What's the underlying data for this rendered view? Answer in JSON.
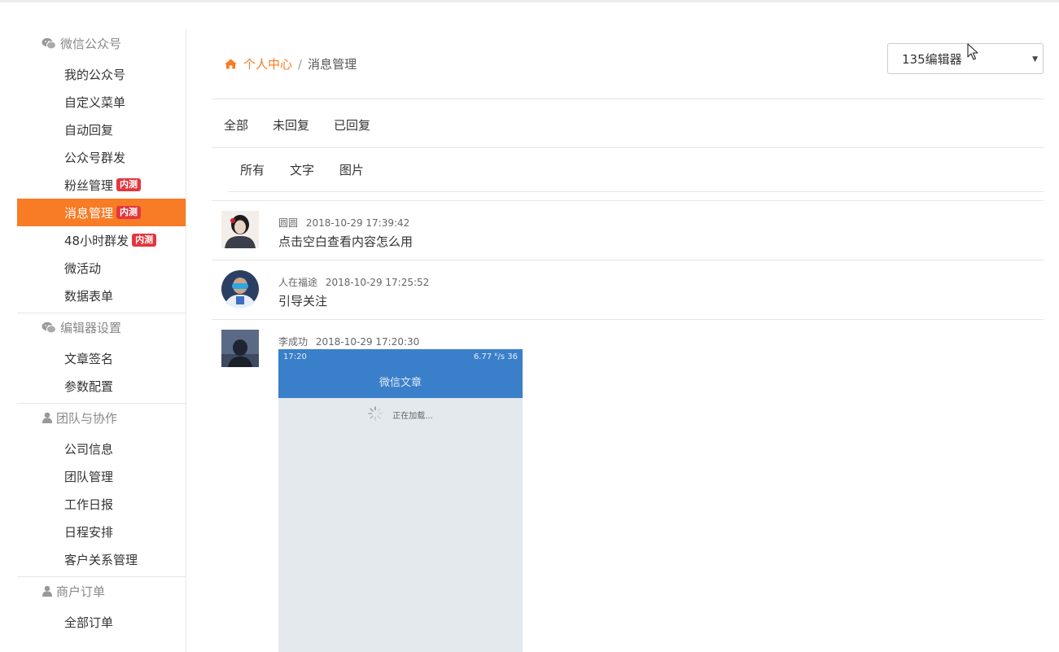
{
  "sidebar": {
    "sections": [
      {
        "title": "微信公众号",
        "icon": "wechat-icon",
        "items": [
          {
            "label": "我的公众号"
          },
          {
            "label": "自定义菜单"
          },
          {
            "label": "自动回复"
          },
          {
            "label": "公众号群发"
          },
          {
            "label": "粉丝管理",
            "badge": "内测"
          },
          {
            "label": "消息管理",
            "badge": "内测",
            "active": true
          },
          {
            "label": "48小时群发",
            "badge": "内测"
          },
          {
            "label": "微活动"
          },
          {
            "label": "数据表单"
          }
        ]
      },
      {
        "title": "编辑器设置",
        "icon": "wechat-icon",
        "items": [
          {
            "label": "文章签名"
          },
          {
            "label": "参数配置"
          }
        ]
      },
      {
        "title": "团队与协作",
        "icon": "user-icon",
        "items": [
          {
            "label": "公司信息"
          },
          {
            "label": "团队管理"
          },
          {
            "label": "工作日报"
          },
          {
            "label": "日程安排"
          },
          {
            "label": "客户关系管理"
          }
        ]
      },
      {
        "title": "商户订单",
        "icon": "user-icon",
        "items": [
          {
            "label": "全部订单"
          }
        ]
      }
    ]
  },
  "breadcrumb": {
    "home": "个人中心",
    "sep": "/",
    "current": "消息管理"
  },
  "account_select": {
    "value": "135编辑器"
  },
  "filter_tabs": [
    "全部",
    "未回复",
    "已回复"
  ],
  "type_tabs": [
    "所有",
    "文字",
    "图片"
  ],
  "messages": [
    {
      "name": "圆圆",
      "time": "2018-10-29 17:39:42",
      "text": "点击空白查看内容怎么用"
    },
    {
      "name": "人在福途",
      "time": "2018-10-29 17:25:52",
      "text": "引导关注"
    },
    {
      "name": "李成功",
      "time": "2018-10-29 17:20:30",
      "image": {
        "status_time": "17:20",
        "status_right": "6.77 ᴷ/s  36",
        "title": "微信文章",
        "loading": "正在加载..."
      }
    }
  ],
  "colors": {
    "accent": "#f87b25",
    "badge": "#e2363f",
    "phone_bar": "#3a7fca"
  }
}
